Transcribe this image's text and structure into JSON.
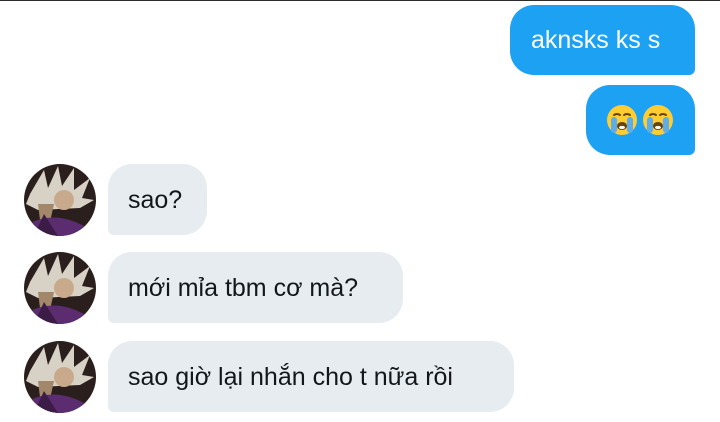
{
  "messages": [
    {
      "direction": "sent",
      "text": "aknsks ks s"
    },
    {
      "direction": "sent",
      "emoji": [
        "loudly-crying-face",
        "loudly-crying-face"
      ]
    },
    {
      "direction": "received",
      "text": "sao?"
    },
    {
      "direction": "received",
      "text": "mới mỉa tbm cơ mà?"
    },
    {
      "direction": "received",
      "text": "sao giờ lại nhắn cho t nữa rồi"
    }
  ],
  "colors": {
    "sent_bubble": "#1da1f2",
    "received_bubble": "#e6ecf0",
    "received_text": "#14171a",
    "background": "#ffffff"
  }
}
